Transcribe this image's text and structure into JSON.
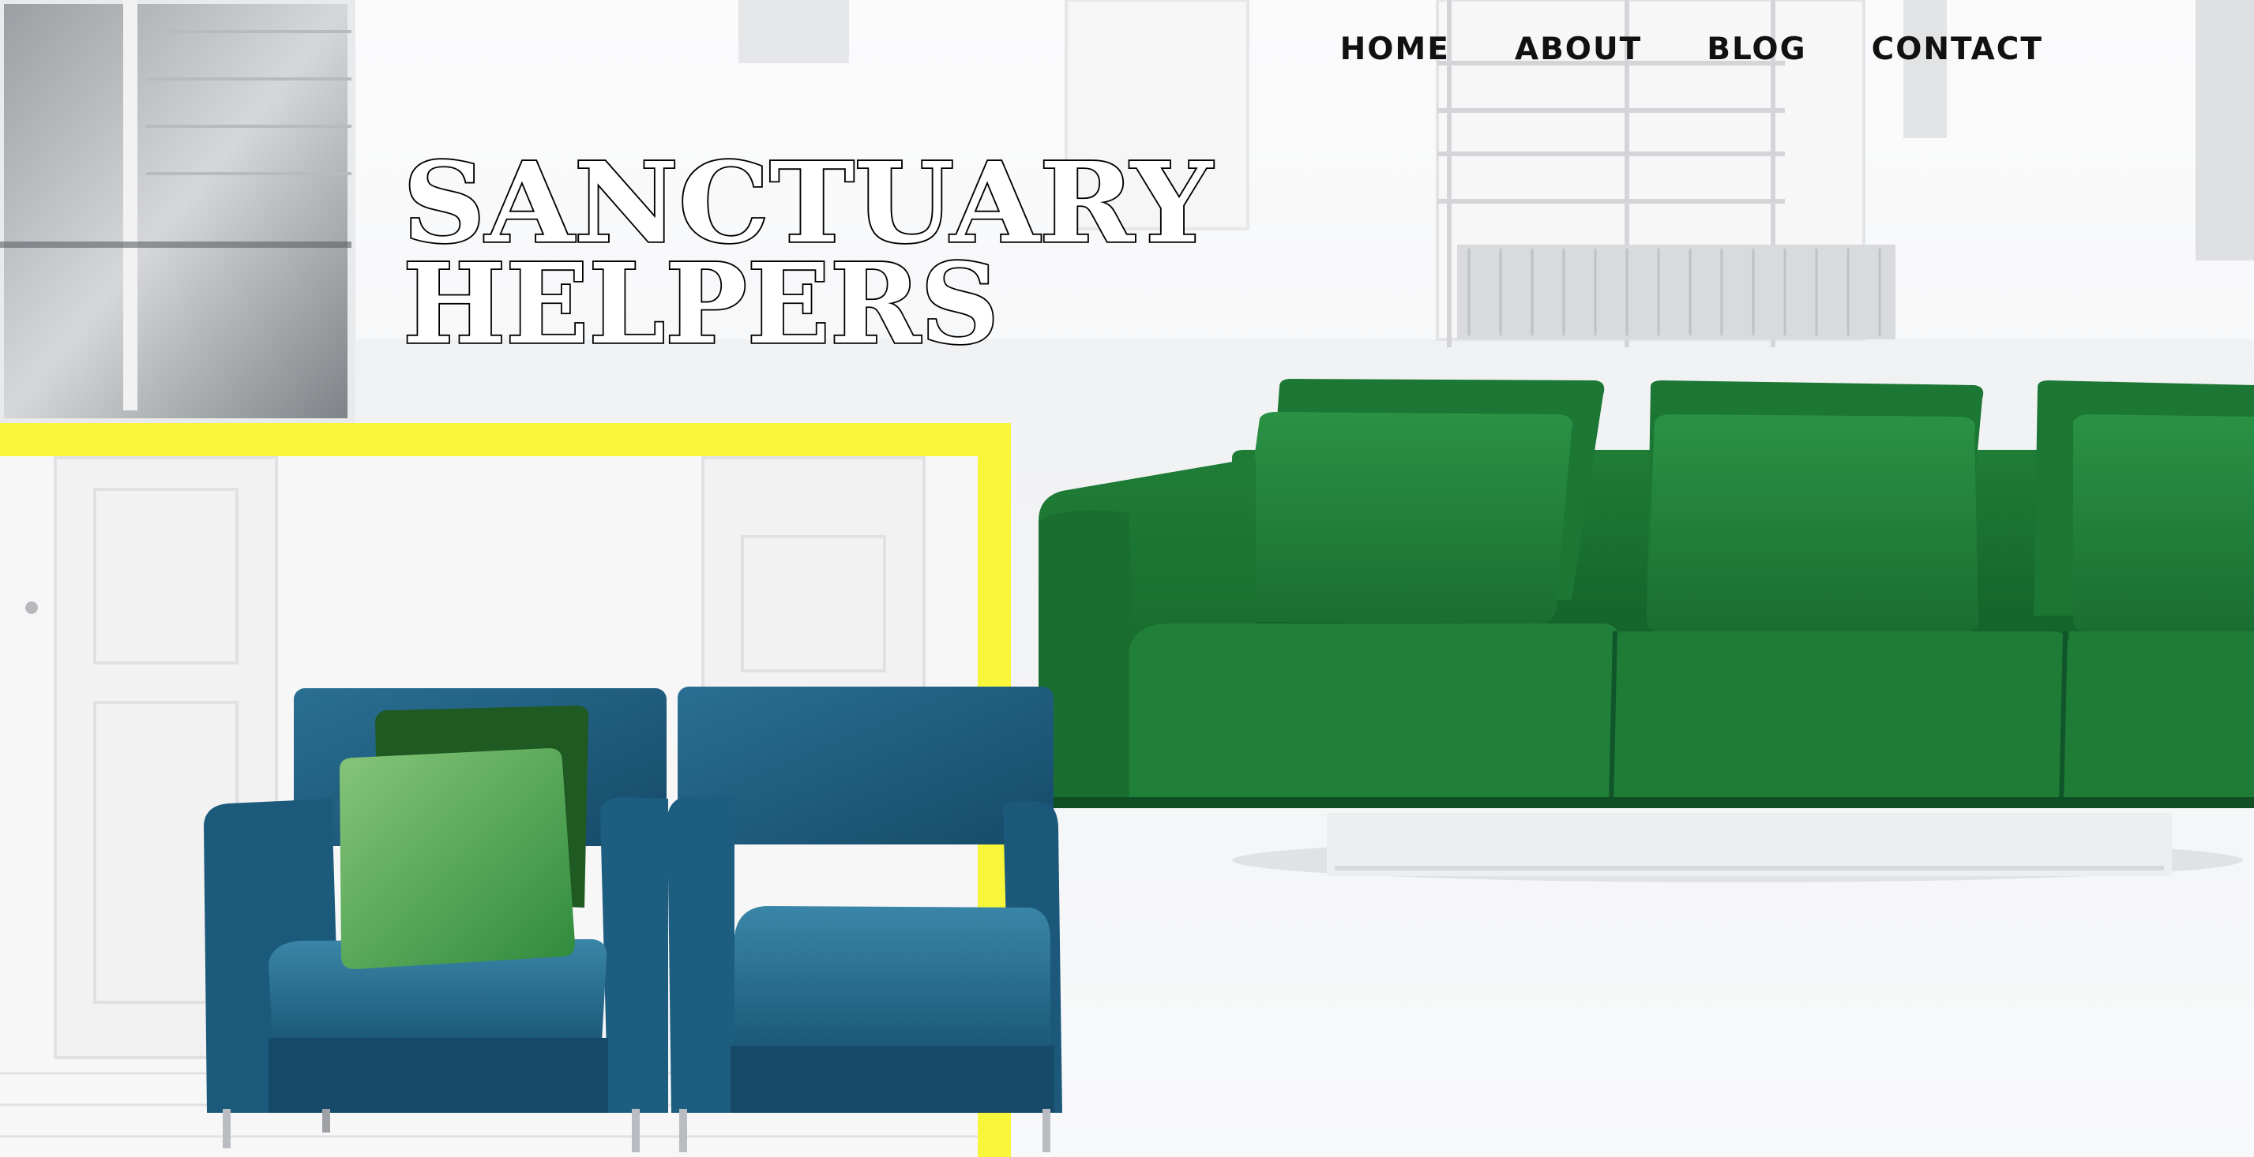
{
  "nav": {
    "items": [
      {
        "label": "HOME"
      },
      {
        "label": "ABOUT"
      },
      {
        "label": "BLOG"
      },
      {
        "label": "CONTACT"
      }
    ]
  },
  "brand": {
    "line1": "SANCTUARY",
    "line2": "HELPERS"
  },
  "colors": {
    "accent_yellow": "#f7f63a",
    "sofa_green": "#1d7a34",
    "armchair_blue": "#1e5a7c"
  }
}
